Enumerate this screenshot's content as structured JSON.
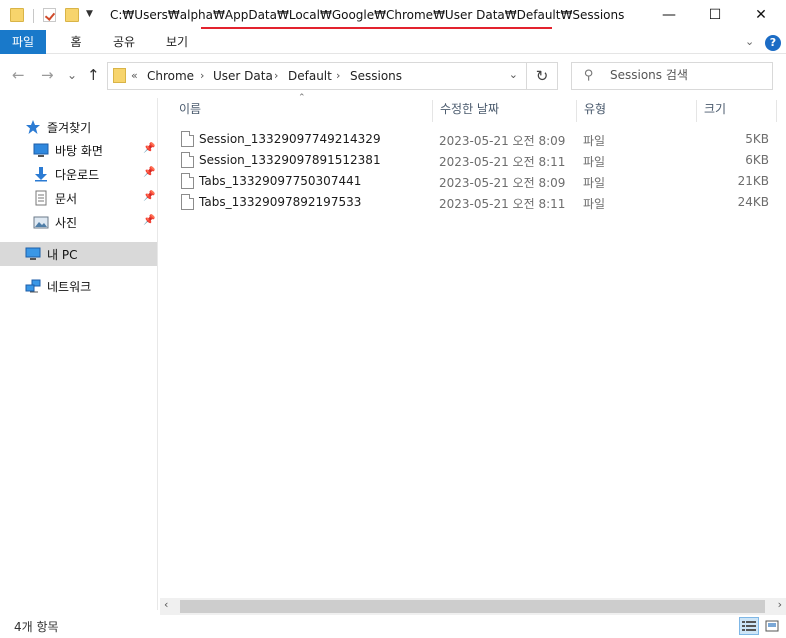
{
  "titlebar": {
    "path": "C:₩Users₩alpha₩AppData₩Local₩Google₩Chrome₩User Data₩Default₩Sessions",
    "underline_color": "#e3232e",
    "minimize_glyph": "—",
    "maximize_glyph": "☐",
    "close_glyph": "✕"
  },
  "ribbon": {
    "tabs": [
      {
        "label": "파일",
        "active": true
      },
      {
        "label": "홈"
      },
      {
        "label": "공유"
      },
      {
        "label": "보기"
      }
    ],
    "accent": "#1979ca",
    "help_glyph": "?"
  },
  "nav": {
    "back_glyph": "←",
    "forward_glyph": "→",
    "recent_glyph": "⌄",
    "up_glyph": "↑"
  },
  "address": {
    "overflow": "«",
    "parts": [
      "Chrome",
      "User Data",
      "Default",
      "Sessions"
    ],
    "refresh_glyph": "↻"
  },
  "search": {
    "placeholder": "Sessions 검색"
  },
  "sidebar": {
    "items": [
      {
        "label": "즐겨찾기",
        "icon": "star-icon",
        "pinned": false
      },
      {
        "label": "바탕 화면",
        "icon": "desktop-icon",
        "pinned": true
      },
      {
        "label": "다운로드",
        "icon": "download-icon",
        "pinned": true
      },
      {
        "label": "문서",
        "icon": "document-icon",
        "pinned": true
      },
      {
        "label": "사진",
        "icon": "pictures-icon",
        "pinned": true
      },
      {
        "label": "내 PC",
        "icon": "pc-icon",
        "selected": true
      },
      {
        "label": "네트워크",
        "icon": "network-icon"
      }
    ]
  },
  "columns": {
    "name": "이름",
    "date": "수정한 날짜",
    "type": "유형",
    "size": "크기"
  },
  "files": [
    {
      "name": "Session_13329097749214329",
      "date": "2023-05-21 오전 8:09",
      "type": "파일",
      "size": "5KB"
    },
    {
      "name": "Session_13329097891512381",
      "date": "2023-05-21 오전 8:11",
      "type": "파일",
      "size": "6KB"
    },
    {
      "name": "Tabs_13329097750307441",
      "date": "2023-05-21 오전 8:09",
      "type": "파일",
      "size": "21KB"
    },
    {
      "name": "Tabs_13329097892197533",
      "date": "2023-05-21 오전 8:11",
      "type": "파일",
      "size": "24KB"
    }
  ],
  "status": {
    "count": "4개 항목"
  }
}
